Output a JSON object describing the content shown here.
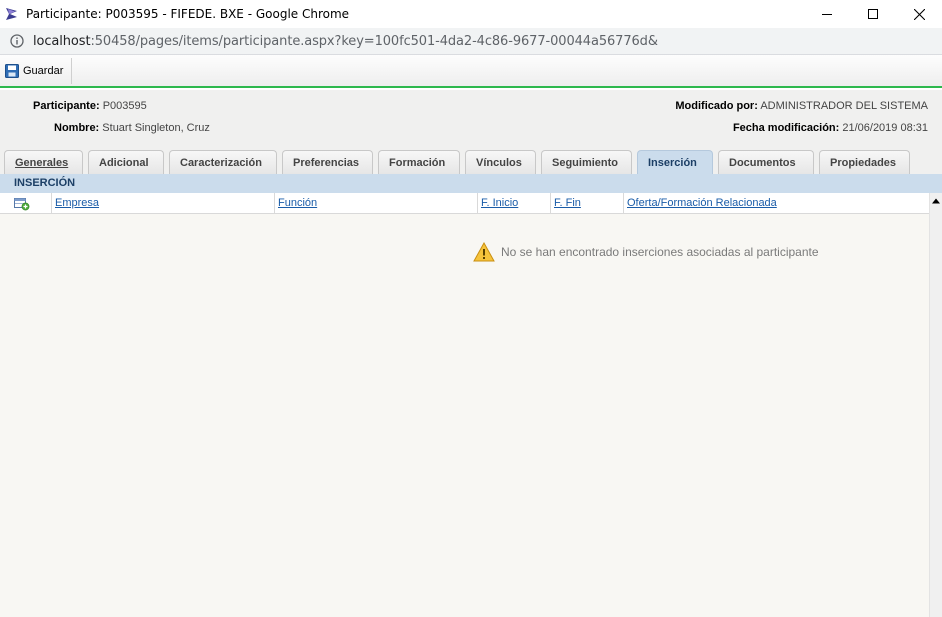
{
  "window": {
    "title": "Participante: P003595 - FIFEDE. BXE - Google Chrome",
    "url_host": "localhost",
    "url_rest": ":50458/pages/items/participante.aspx?key=100fc501-4da2-4c86-9677-00044a56776d&"
  },
  "toolbar": {
    "save_label": "Guardar"
  },
  "header": {
    "participante_label": "Participante:",
    "participante_value": "P003595",
    "nombre_label": "Nombre:",
    "nombre_value": "Stuart Singleton, Cruz",
    "modificado_label": "Modificado por:",
    "modificado_value": "ADMINISTRADOR DEL SISTEMA",
    "fecha_label": "Fecha modificación:",
    "fecha_value": "21/06/2019 08:31"
  },
  "tabs": [
    {
      "label": "Generales"
    },
    {
      "label": "Adicional"
    },
    {
      "label": "Caracterización"
    },
    {
      "label": "Preferencias"
    },
    {
      "label": "Formación"
    },
    {
      "label": "Vínculos"
    },
    {
      "label": "Seguimiento"
    },
    {
      "label": "Inserción"
    },
    {
      "label": "Documentos"
    },
    {
      "label": "Propiedades"
    }
  ],
  "active_tab": "Inserción",
  "section": {
    "title": "INSERCIÓN"
  },
  "grid": {
    "columns": [
      "Empresa",
      "Función",
      "F. Inicio",
      "F. Fin",
      "Oferta/Formación Relacionada"
    ],
    "empty_message": "No se han encontrado inserciones asociadas al participante"
  },
  "colors": {
    "accent_green": "#2db84d",
    "tab_active_bg": "#cbdcec",
    "link_blue": "#1a5ca8"
  },
  "icons": [
    "app-icon",
    "minimize-icon",
    "maximize-icon",
    "close-icon",
    "info-icon",
    "save-icon",
    "add-row-icon",
    "warning-icon",
    "scroll-up-arrow-icon"
  ]
}
